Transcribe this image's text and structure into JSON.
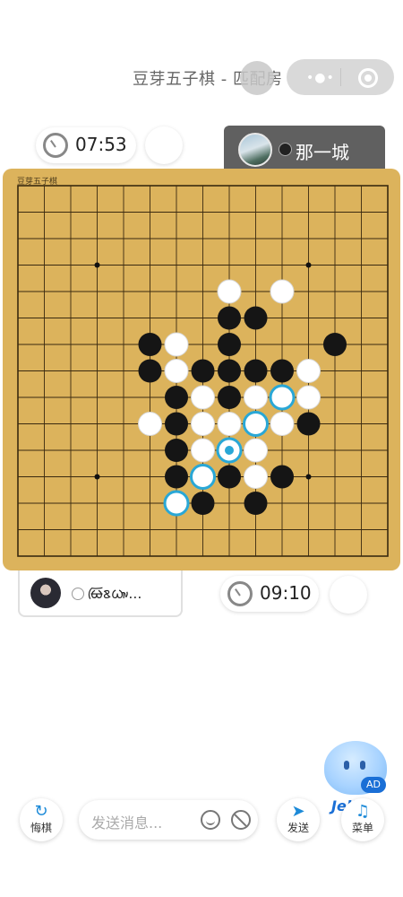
{
  "header": {
    "title": "豆芽五子棋 - 匹配房"
  },
  "opponent": {
    "timer": "07:53",
    "name": "那一城",
    "stone_color": "black"
  },
  "self": {
    "timer": "09:10",
    "name": "ᰄᰩᰣᰃᰥᰤ…",
    "stone_color": "white"
  },
  "board": {
    "label": "豆芽五子棋",
    "size": 15,
    "star_points": [
      [
        3,
        3
      ],
      [
        11,
        3
      ],
      [
        3,
        11
      ],
      [
        11,
        11
      ]
    ],
    "stones": [
      {
        "col": 8,
        "row": 4,
        "color": "white"
      },
      {
        "col": 10,
        "row": 4,
        "color": "white"
      },
      {
        "col": 8,
        "row": 5,
        "color": "black"
      },
      {
        "col": 9,
        "row": 5,
        "color": "black"
      },
      {
        "col": 5,
        "row": 6,
        "color": "black"
      },
      {
        "col": 6,
        "row": 6,
        "color": "white"
      },
      {
        "col": 8,
        "row": 6,
        "color": "black"
      },
      {
        "col": 12,
        "row": 6,
        "color": "black"
      },
      {
        "col": 5,
        "row": 7,
        "color": "black"
      },
      {
        "col": 6,
        "row": 7,
        "color": "white"
      },
      {
        "col": 7,
        "row": 7,
        "color": "black"
      },
      {
        "col": 8,
        "row": 7,
        "color": "black"
      },
      {
        "col": 9,
        "row": 7,
        "color": "black"
      },
      {
        "col": 10,
        "row": 7,
        "color": "black"
      },
      {
        "col": 11,
        "row": 7,
        "color": "white"
      },
      {
        "col": 6,
        "row": 8,
        "color": "black"
      },
      {
        "col": 7,
        "row": 8,
        "color": "white"
      },
      {
        "col": 8,
        "row": 8,
        "color": "black"
      },
      {
        "col": 9,
        "row": 8,
        "color": "white"
      },
      {
        "col": 10,
        "row": 8,
        "color": "white",
        "highlight": true
      },
      {
        "col": 11,
        "row": 8,
        "color": "white"
      },
      {
        "col": 5,
        "row": 9,
        "color": "white"
      },
      {
        "col": 6,
        "row": 9,
        "color": "black"
      },
      {
        "col": 7,
        "row": 9,
        "color": "white"
      },
      {
        "col": 8,
        "row": 9,
        "color": "white"
      },
      {
        "col": 9,
        "row": 9,
        "color": "white",
        "highlight": true
      },
      {
        "col": 10,
        "row": 9,
        "color": "white"
      },
      {
        "col": 11,
        "row": 9,
        "color": "black"
      },
      {
        "col": 6,
        "row": 10,
        "color": "black"
      },
      {
        "col": 7,
        "row": 10,
        "color": "white"
      },
      {
        "col": 8,
        "row": 10,
        "color": "white",
        "last_move": true
      },
      {
        "col": 9,
        "row": 10,
        "color": "white"
      },
      {
        "col": 6,
        "row": 11,
        "color": "black"
      },
      {
        "col": 7,
        "row": 11,
        "color": "white",
        "highlight": true
      },
      {
        "col": 8,
        "row": 11,
        "color": "black"
      },
      {
        "col": 9,
        "row": 11,
        "color": "white"
      },
      {
        "col": 10,
        "row": 11,
        "color": "black"
      },
      {
        "col": 6,
        "row": 12,
        "color": "white",
        "highlight": true
      },
      {
        "col": 7,
        "row": 12,
        "color": "black"
      },
      {
        "col": 9,
        "row": 12,
        "color": "black"
      }
    ],
    "colors": {
      "wood": "#dcb35c",
      "line": "#3a2a10",
      "highlight": "#29a7d6"
    }
  },
  "bottom": {
    "undo_label": "悔棋",
    "message_placeholder": "发送消息...",
    "send_label": "发送",
    "menu_label": "菜单",
    "ad_label": "AD",
    "jelly_label": "Jelly"
  }
}
